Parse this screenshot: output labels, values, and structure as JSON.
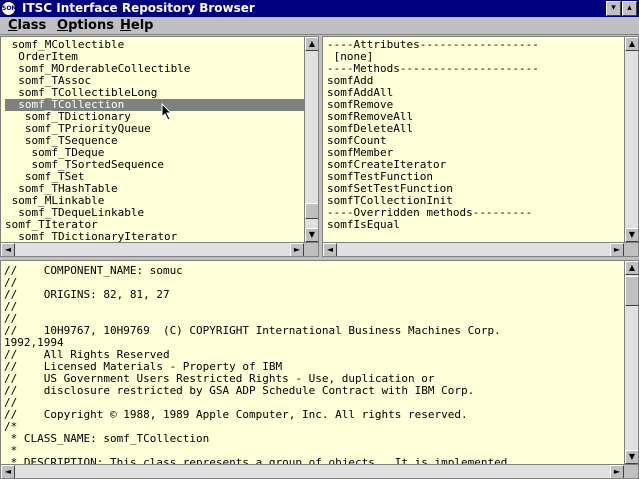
{
  "window": {
    "title": "ITSC Interface Repository Browser",
    "system_icon": "SOM",
    "minimize_glyph": "▾",
    "maximize_glyph": "▴"
  },
  "menubar": {
    "items": [
      {
        "label": "Class",
        "mnemonic": "C",
        "rest": "lass"
      },
      {
        "label": "Options",
        "mnemonic": "O",
        "rest": "ptions"
      },
      {
        "label": "Help",
        "mnemonic": "H",
        "rest": "elp"
      }
    ]
  },
  "class_tree": {
    "selected_index": 6,
    "items": [
      " somf_MCollectible",
      "  OrderItem",
      "  somf_MOrderableCollectible",
      "  somf_TAssoc",
      "  somf_TCollectibleLong",
      "  somf_TCollection",
      "   somf_TDictionary",
      "   somf_TPriorityQueue",
      "   somf_TSequence",
      "    somf_TDeque",
      "    somf_TSortedSequence",
      "   somf_TSet",
      "  somf_THashTable",
      " somf_MLinkable",
      "  somf_TDequeLinkable",
      "somf_TIterator",
      "  somf_TDictionaryIterator"
    ]
  },
  "members": {
    "items": [
      "----Attributes------------------",
      " [none]",
      "----Methods---------------------",
      "somfAdd",
      "somfAddAll",
      "somfRemove",
      "somfRemoveAll",
      "somfDeleteAll",
      "somfCount",
      "somfMember",
      "somfCreateIterator",
      "somfTestFunction",
      "somfSetTestFunction",
      "somfTCollectionInit",
      "----Overridden methods---------",
      "somfIsEqual"
    ]
  },
  "source": {
    "lines": [
      "//    COMPONENT_NAME: somuc",
      "//",
      "//    ORIGINS: 82, 81, 27",
      "//",
      "//",
      "//    10H9767, 10H9769  (C) COPYRIGHT International Business Machines Corp.",
      "1992,1994",
      "//    All Rights Reserved",
      "//    Licensed Materials - Property of IBM",
      "//    US Government Users Restricted Rights - Use, duplication or",
      "//    disclosure restricted by GSA ADP Schedule Contract with IBM Corp.",
      "//",
      "//    Copyright © 1988, 1989 Apple Computer, Inc. All rights reserved.",
      "/*",
      " * CLASS_NAME: somf_TCollection",
      " *",
      " * DESCRIPTION: This class represents a group of objects.  It is implemented"
    ]
  },
  "scroll_glyphs": {
    "up": "▲",
    "down": "▼",
    "left": "◄",
    "right": "►"
  }
}
